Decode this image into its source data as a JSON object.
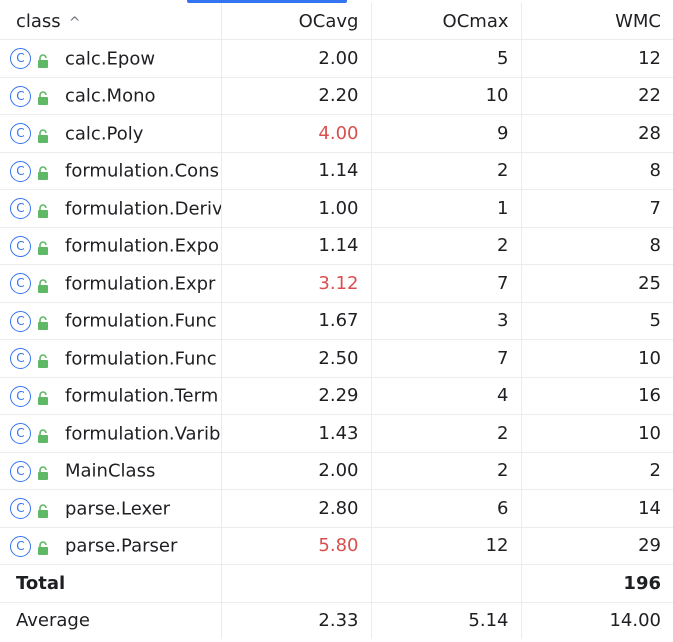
{
  "columns": [
    {
      "label": "class",
      "sort": "ascending"
    },
    {
      "label": "OCavg"
    },
    {
      "label": "OCmax"
    },
    {
      "label": "WMC"
    }
  ],
  "rows": [
    {
      "name": "calc.Epow",
      "ocavg": "2.00",
      "ocmax": "5",
      "wmc": "12",
      "warn": false
    },
    {
      "name": "calc.Mono",
      "ocavg": "2.20",
      "ocmax": "10",
      "wmc": "22",
      "warn": false
    },
    {
      "name": "calc.Poly",
      "ocavg": "4.00",
      "ocmax": "9",
      "wmc": "28",
      "warn": true
    },
    {
      "name": "formulation.Cons",
      "ocavg": "1.14",
      "ocmax": "2",
      "wmc": "8",
      "warn": false
    },
    {
      "name": "formulation.Deriv",
      "ocavg": "1.00",
      "ocmax": "1",
      "wmc": "7",
      "warn": false
    },
    {
      "name": "formulation.Expo",
      "ocavg": "1.14",
      "ocmax": "2",
      "wmc": "8",
      "warn": false
    },
    {
      "name": "formulation.Expr",
      "ocavg": "3.12",
      "ocmax": "7",
      "wmc": "25",
      "warn": true
    },
    {
      "name": "formulation.Func",
      "ocavg": "1.67",
      "ocmax": "3",
      "wmc": "5",
      "warn": false
    },
    {
      "name": "formulation.Func",
      "ocavg": "2.50",
      "ocmax": "7",
      "wmc": "10",
      "warn": false
    },
    {
      "name": "formulation.Term",
      "ocavg": "2.29",
      "ocmax": "4",
      "wmc": "16",
      "warn": false
    },
    {
      "name": "formulation.Varib",
      "ocavg": "1.43",
      "ocmax": "2",
      "wmc": "10",
      "warn": false
    },
    {
      "name": "MainClass",
      "ocavg": "2.00",
      "ocmax": "2",
      "wmc": "2",
      "warn": false
    },
    {
      "name": "parse.Lexer",
      "ocavg": "2.80",
      "ocmax": "6",
      "wmc": "14",
      "warn": false
    },
    {
      "name": "parse.Parser",
      "ocavg": "5.80",
      "ocmax": "12",
      "wmc": "29",
      "warn": true
    }
  ],
  "total": {
    "label": "Total",
    "ocavg": "",
    "ocmax": "",
    "wmc": "196"
  },
  "average": {
    "label": "Average",
    "ocavg": "2.33",
    "ocmax": "5.14",
    "wmc": "14.00"
  },
  "class_icon_glyph": "C",
  "icons": {
    "class": "class-icon",
    "visibility": "public-lock-icon"
  },
  "colors": {
    "accent": "#3574f0",
    "warning": "#d94f4f",
    "lock": "#5fb865"
  }
}
